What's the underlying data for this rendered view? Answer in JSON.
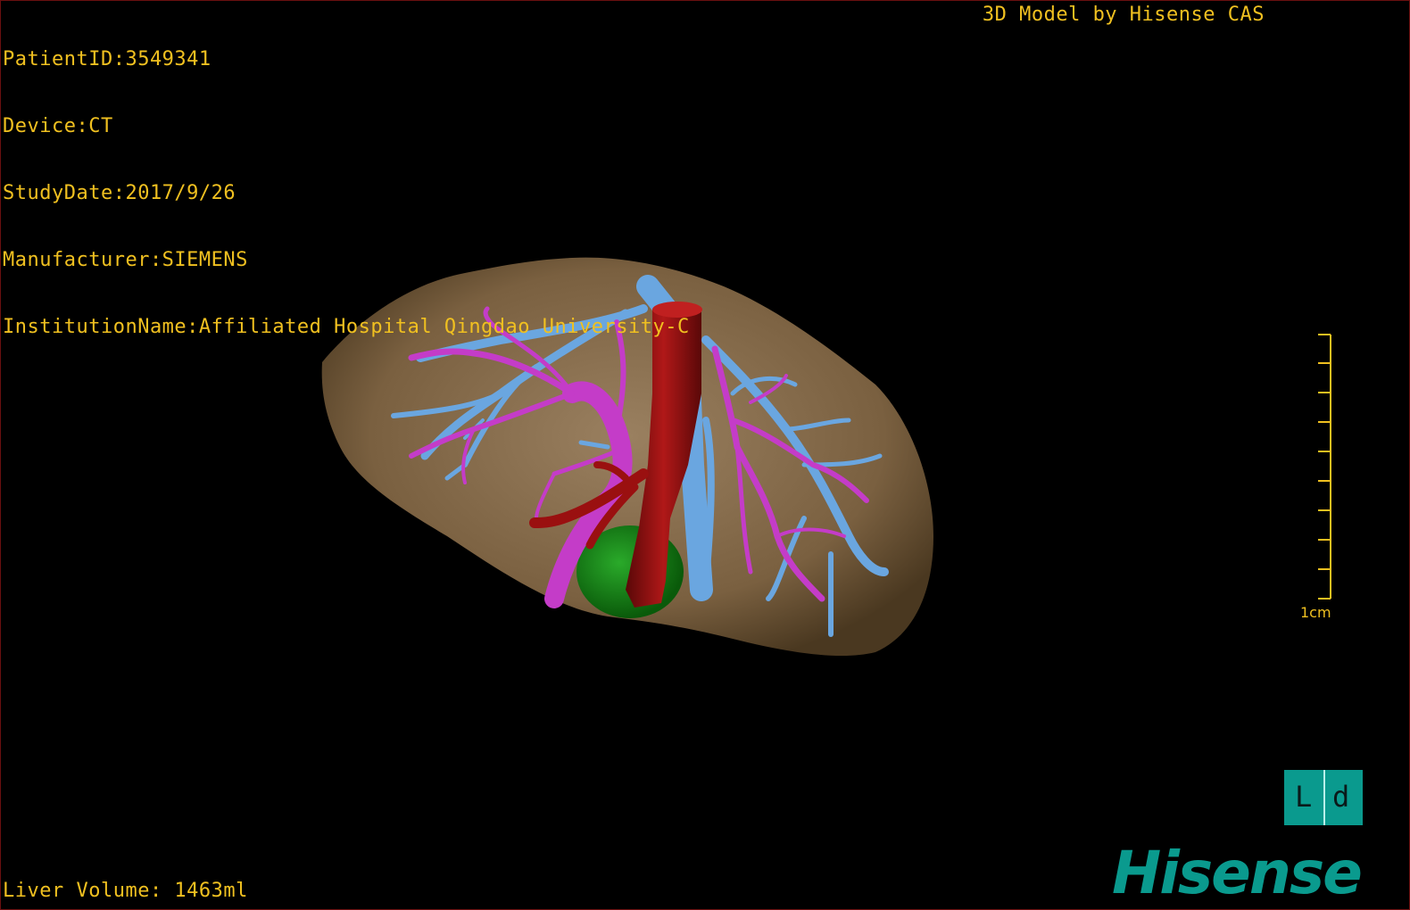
{
  "header": {
    "patient_id": "PatientID:3549341",
    "device": "Device:CT",
    "study_date": "StudyDate:2017/9/26",
    "manufacturer": "Manufacturer:SIEMENS",
    "institution": "InstitutionName:Affiliated Hospital Qingdao University-C",
    "credit": "3D Model by Hisense CAS"
  },
  "footer": {
    "liver_volume": "Liver Volume: 1463ml"
  },
  "scale": {
    "label": "1cm"
  },
  "view_cube": {
    "left_glyph": "L",
    "right_glyph": "d"
  },
  "logo": {
    "text": "Hisense"
  },
  "colors": {
    "overlay_text": "#f0c020",
    "liver": "#8a7050",
    "hepatic_vein": "#6aa6e0",
    "portal_vein": "#c43cc8",
    "ivc": "#9a1010",
    "gallbladder": "#1a8a1a",
    "brand": "#0a9a8e"
  }
}
